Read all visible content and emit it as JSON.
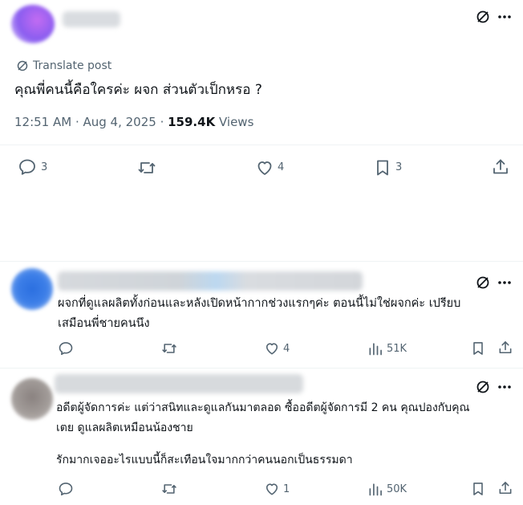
{
  "main_post": {
    "translate_label": "Translate post",
    "text": "คุณพี่คนนี้คือใครค่ะ ผจก ส่วนตัวเป็กหรอ ?",
    "timestamp": "12:51 AM · Aug 4, 2025 · ",
    "views_count": "159.4K",
    "views_label": " Views",
    "actions": {
      "reply_count": "3",
      "repost_count": "",
      "like_count": "4",
      "bookmark_count": "3"
    }
  },
  "replies": [
    {
      "text_line1": "ผจกที่ดูแลผลิตทั้งก่อนและหลังเปิดหน้ากากช่วงแรกๆค่ะ ตอนนี้ไม่ใช่ผจกค่ะ เปรียบ",
      "text_line2": "เสมือนพี่ชายคนนึง",
      "actions": {
        "reply_count": "",
        "repost_count": "",
        "like_count": "4",
        "views_count": "51K"
      }
    },
    {
      "text_line1": "อดีตผู้จัดการค่ะ แต่ว่าสนิทและดูแลกันมาตลอด ซื้ออดีตผู้จัดการมี 2 คน คุณปองกับคุณ",
      "text_line2": "เตย ดูแลผลิตเหมือนน้องชาย",
      "text_line3": "รักมากเจออะไรแบบนี้ก็สะเทือนใจมากกว่าคนนอกเป็นธรรมดา",
      "actions": {
        "reply_count": "",
        "repost_count": "",
        "like_count": "1",
        "views_count": "50K"
      }
    }
  ],
  "colors": {
    "text": "#0f1419",
    "muted": "#536471",
    "divider": "#eff3f4"
  }
}
